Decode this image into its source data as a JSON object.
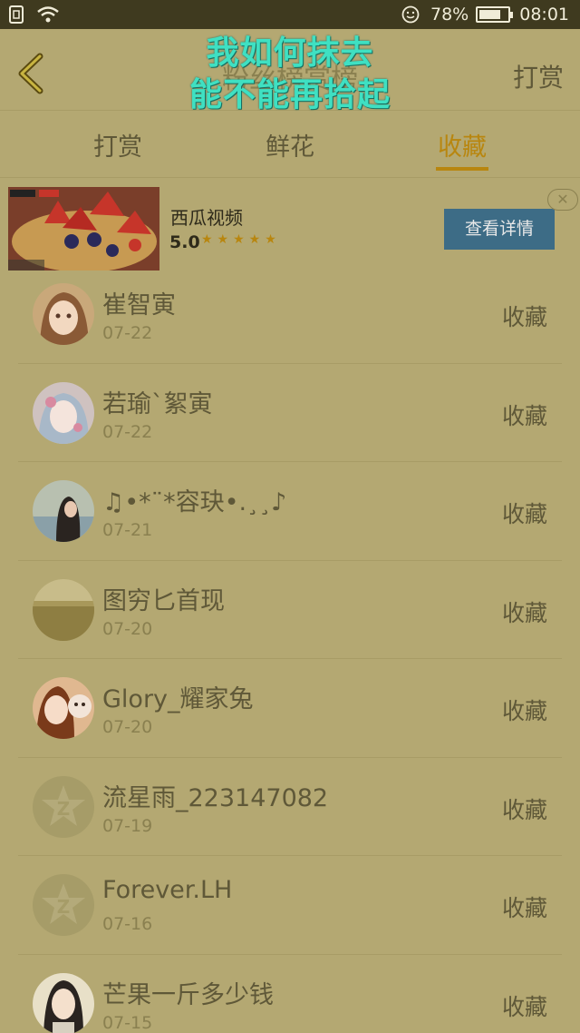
{
  "status_bar": {
    "battery_percent": "78%",
    "time": "08:01",
    "battery_level": 0.78
  },
  "header": {
    "title": "粉丝榜赏榜",
    "action_label": "打赏",
    "overlay_line1": "我如何抹去",
    "overlay_line2": "能不能再拾起"
  },
  "tabs": [
    {
      "label": "打赏",
      "active": false
    },
    {
      "label": "鲜花",
      "active": false
    },
    {
      "label": "收藏",
      "active": true
    }
  ],
  "ad": {
    "title": "西瓜视频",
    "rating": "5.0",
    "stars": "★★★★★",
    "button_label": "查看详情",
    "close_glyph": "✕"
  },
  "list": [
    {
      "name": "崔智寅",
      "date": "07-22",
      "action": "收藏",
      "avatar": "anime-girl"
    },
    {
      "name": "若瑜`絮寅",
      "date": "07-22",
      "action": "收藏",
      "avatar": "anime-girl-light"
    },
    {
      "name": "♫•*¨*容玦•.¸¸♪",
      "date": "07-21",
      "action": "收藏",
      "avatar": "girl-photo"
    },
    {
      "name": "图穷匕首现",
      "date": "07-20",
      "action": "收藏",
      "avatar": "landscape"
    },
    {
      "name": "Glory_耀家兔",
      "date": "07-20",
      "action": "收藏",
      "avatar": "anime-couple"
    },
    {
      "name": "流星雨_223147082",
      "date": "07-19",
      "action": "收藏",
      "avatar": "default-z"
    },
    {
      "name": "Forever.LH",
      "date": "07-16",
      "action": "收藏",
      "avatar": "default-z"
    },
    {
      "name": "芒果一斤多少钱",
      "date": "07-15",
      "action": "收藏",
      "avatar": "girl-portrait"
    }
  ],
  "colors": {
    "background": "#b4a872",
    "accent": "#b8860f",
    "ad_button": "#3d6c86",
    "overlay_text": "#3fe0c2"
  }
}
